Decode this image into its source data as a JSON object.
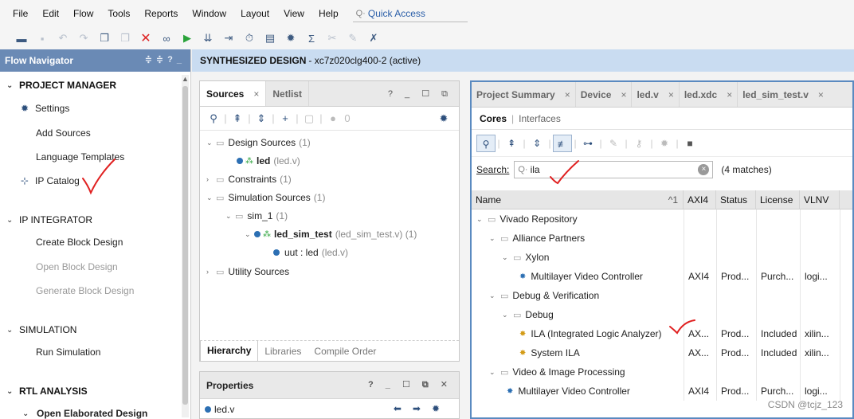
{
  "menu": [
    "File",
    "Edit",
    "Flow",
    "Tools",
    "Reports",
    "Window",
    "Layout",
    "View",
    "Help"
  ],
  "quick_access": "Quick Access",
  "toolbar_icons": [
    "open-icon",
    "save-icon",
    "undo-icon",
    "redo-icon",
    "copy-icon",
    "paste-icon",
    "delete-icon",
    "link-icon",
    "run-icon",
    "step-icon",
    "restart-icon",
    "timer-icon",
    "report-icon",
    "settings-icon",
    "sigma-icon",
    "cut-icon",
    "edit-icon",
    "cross-icon"
  ],
  "flow_nav": {
    "title": "Flow Navigator",
    "project_manager": "PROJECT MANAGER",
    "pm_items": [
      "Settings",
      "Add Sources",
      "Language Templates",
      "IP Catalog"
    ],
    "ip_integrator": "IP INTEGRATOR",
    "ipi_items": [
      "Create Block Design",
      "Open Block Design",
      "Generate Block Design"
    ],
    "simulation": "SIMULATION",
    "sim_items": [
      "Run Simulation"
    ],
    "rtl_analysis": "RTL ANALYSIS",
    "rtl_items": [
      "Open Elaborated Design"
    ]
  },
  "design_header": {
    "bold": "SYNTHESIZED DESIGN",
    "rest": "- xc7z020clg400-2  (active)"
  },
  "sources": {
    "tab_sources": "Sources",
    "tab_netlist": "Netlist",
    "ctrls": "? _ ☐ ⧉",
    "count_label": "0",
    "tree": {
      "design_sources": "Design Sources",
      "design_sources_count": "(1)",
      "led": "led",
      "led_file": "(led.v)",
      "constraints": "Constraints",
      "constraints_count": "(1)",
      "sim_sources": "Simulation Sources",
      "sim_sources_count": "(1)",
      "sim_1": "sim_1",
      "sim_1_count": "(1)",
      "led_sim_test": "led_sim_test",
      "led_sim_test_file": "(led_sim_test.v) (1)",
      "uut": "uut : led",
      "uut_file": "(led.v)",
      "utility": "Utility Sources"
    },
    "bottom_tabs": [
      "Hierarchy",
      "Libraries",
      "Compile Order"
    ]
  },
  "properties": {
    "title": "Properties",
    "ctrls": "? _ ☐ ⧉ ✕",
    "file": "led.v"
  },
  "ip_panel": {
    "tabs": [
      "Project Summary",
      "Device",
      "led.v",
      "led.xdc",
      "led_sim_test.v"
    ],
    "subtab_active": "Cores",
    "subtab_other": "Interfaces",
    "search_label": "Search:",
    "search_value": "ila",
    "matches": "(4 matches)",
    "columns": [
      "Name",
      "AXI4",
      "Status",
      "License",
      "VLNV"
    ],
    "sort_indicator": "^1",
    "rows": [
      {
        "level": 0,
        "kind": "folder",
        "name": "Vivado Repository",
        "axi": "",
        "status": "",
        "license": "",
        "vlnv": ""
      },
      {
        "level": 1,
        "kind": "folder",
        "name": "Alliance Partners",
        "axi": "",
        "status": "",
        "license": "",
        "vlnv": ""
      },
      {
        "level": 2,
        "kind": "folder",
        "name": "Xylon",
        "axi": "",
        "status": "",
        "license": "",
        "vlnv": ""
      },
      {
        "level": 3,
        "kind": "ip-blue",
        "name": "Multilayer Video Controller",
        "axi": "AXI4",
        "status": "Prod...",
        "license": "Purch...",
        "vlnv": "logi..."
      },
      {
        "level": 1,
        "kind": "folder",
        "name": "Debug & Verification",
        "axi": "",
        "status": "",
        "license": "",
        "vlnv": ""
      },
      {
        "level": 2,
        "kind": "folder",
        "name": "Debug",
        "axi": "",
        "status": "",
        "license": "",
        "vlnv": ""
      },
      {
        "level": 3,
        "kind": "ip",
        "name": "ILA (Integrated Logic Analyzer)",
        "axi": "AX...",
        "status": "Prod...",
        "license": "Included",
        "vlnv": "xilin..."
      },
      {
        "level": 3,
        "kind": "ip",
        "name": "System ILA",
        "axi": "AX...",
        "status": "Prod...",
        "license": "Included",
        "vlnv": "xilin..."
      },
      {
        "level": 1,
        "kind": "folder",
        "name": "Video & Image Processing",
        "axi": "",
        "status": "",
        "license": "",
        "vlnv": ""
      },
      {
        "level": 2,
        "kind": "ip-blue",
        "name": "Multilayer Video Controller",
        "axi": "AXI4",
        "status": "Prod...",
        "license": "Purch...",
        "vlnv": "logi..."
      }
    ]
  },
  "watermark": "CSDN @tcjz_123",
  "colors": {
    "flow_nav_header": "#6a8ab5",
    "design_header": "#c9dcf1",
    "ip_panel_border": "#5a8ac0",
    "annotation_red": "#e02020"
  }
}
